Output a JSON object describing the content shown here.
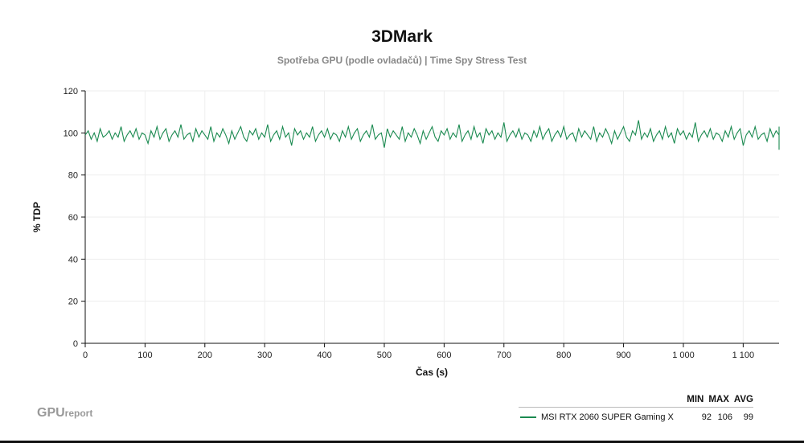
{
  "chart_data": {
    "type": "line",
    "title": "3DMark",
    "subtitle": "Spotřeba GPU (podle ovladačů) | Time Spy Stress Test",
    "xlabel": "Čas (s)",
    "ylabel": "% TDP",
    "xlim": [
      0,
      1160
    ],
    "ylim": [
      0,
      120
    ],
    "xticks": [
      0,
      100,
      200,
      300,
      400,
      500,
      600,
      700,
      800,
      900,
      1000,
      1100
    ],
    "xtick_labels": [
      "0",
      "100",
      "200",
      "300",
      "400",
      "500",
      "600",
      "700",
      "800",
      "900",
      "1 000",
      "1 100"
    ],
    "yticks": [
      0,
      20,
      40,
      60,
      80,
      100,
      120
    ],
    "grid": true,
    "x_step": 5,
    "series": [
      {
        "name": "MSI RTX 2060 SUPER Gaming X",
        "color": "#1a8a50",
        "min": 92,
        "max": 106,
        "avg": 99,
        "values": [
          99,
          101,
          97,
          100,
          96,
          102,
          98,
          99,
          101,
          97,
          100,
          98,
          103,
          96,
          99,
          101,
          98,
          102,
          97,
          100,
          99,
          95,
          101,
          98,
          103,
          97,
          100,
          102,
          96,
          99,
          101,
          98,
          104,
          97,
          99,
          100,
          96,
          102,
          98,
          101,
          99,
          97,
          103,
          96,
          100,
          98,
          102,
          99,
          95,
          101,
          97,
          100,
          103,
          98,
          96,
          101,
          99,
          102,
          97,
          100,
          98,
          104,
          96,
          99,
          101,
          97,
          103,
          98,
          100,
          94,
          102,
          99,
          101,
          97,
          100,
          98,
          103,
          96,
          99,
          101,
          98,
          102,
          97,
          100,
          99,
          96,
          101,
          98,
          103,
          97,
          100,
          102,
          96,
          99,
          101,
          98,
          104,
          97,
          99,
          100,
          93,
          102,
          98,
          101,
          99,
          97,
          103,
          96,
          100,
          98,
          102,
          99,
          95,
          101,
          97,
          100,
          103,
          98,
          96,
          101,
          99,
          102,
          97,
          100,
          98,
          104,
          96,
          99,
          101,
          97,
          103,
          98,
          100,
          95,
          102,
          99,
          101,
          97,
          100,
          98,
          105,
          96,
          99,
          101,
          98,
          102,
          97,
          100,
          99,
          96,
          101,
          98,
          103,
          97,
          100,
          102,
          96,
          99,
          101,
          98,
          103,
          97,
          99,
          100,
          96,
          102,
          98,
          101,
          99,
          97,
          103,
          96,
          100,
          98,
          102,
          99,
          95,
          101,
          97,
          100,
          103,
          98,
          96,
          101,
          99,
          106,
          97,
          100,
          98,
          102,
          96,
          99,
          101,
          97,
          103,
          98,
          100,
          95,
          102,
          99,
          101,
          97,
          100,
          98,
          105,
          96,
          99,
          101,
          98,
          102,
          97,
          100,
          99,
          96,
          101,
          98,
          103,
          97,
          100,
          102,
          94,
          99,
          101,
          98,
          103,
          97,
          99,
          100,
          96,
          102,
          98,
          101,
          99,
          97,
          103,
          96,
          100,
          98,
          102,
          99,
          95,
          101,
          97,
          100,
          103,
          98,
          96,
          101,
          99,
          102,
          97,
          100,
          98,
          92
        ]
      }
    ]
  },
  "legend": {
    "headers": [
      "MIN",
      "MAX",
      "AVG"
    ],
    "rows": [
      {
        "name": "MSI RTX 2060 SUPER Gaming X",
        "min": "92",
        "max": "106",
        "avg": "99"
      }
    ]
  },
  "logo": {
    "bold": "GPU",
    "light": "report"
  }
}
